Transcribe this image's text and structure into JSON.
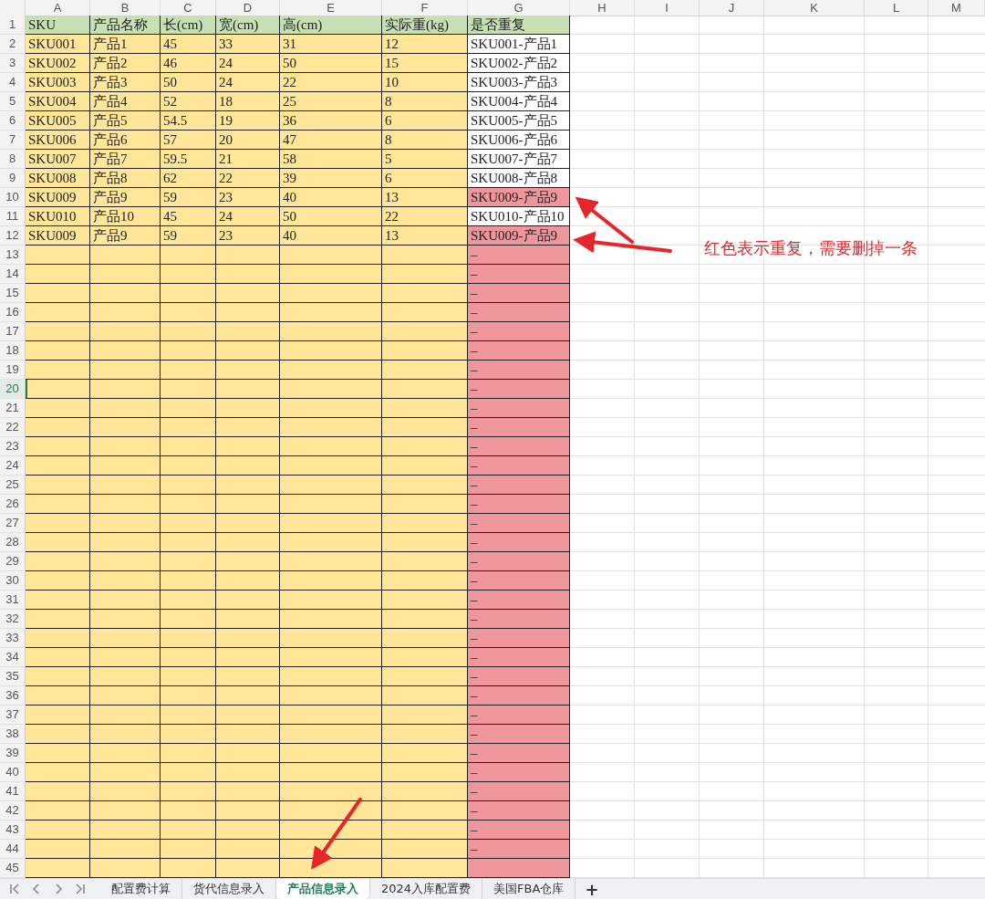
{
  "columns": [
    "A",
    "B",
    "C",
    "D",
    "E",
    "F",
    "G",
    "H",
    "I",
    "J",
    "K",
    "L",
    "M"
  ],
  "rows": [
    {
      "num": "1",
      "kind": "header",
      "selected": false,
      "cells": [
        "SKU",
        "产品名称",
        "长(cm)",
        "宽(cm)",
        "高(cm)",
        "实际重(kg)",
        "是否重复"
      ]
    },
    {
      "num": "2",
      "kind": "data",
      "selected": false,
      "duplicate": false,
      "cells": [
        "SKU001",
        "产品1",
        "45",
        "33",
        "31",
        "12",
        "SKU001-产品1"
      ]
    },
    {
      "num": "3",
      "kind": "data",
      "selected": false,
      "duplicate": false,
      "cells": [
        "SKU002",
        "产品2",
        "46",
        "24",
        "50",
        "15",
        "SKU002-产品2"
      ]
    },
    {
      "num": "4",
      "kind": "data",
      "selected": false,
      "duplicate": false,
      "cells": [
        "SKU003",
        "产品3",
        "50",
        "24",
        "22",
        "10",
        "SKU003-产品3"
      ]
    },
    {
      "num": "5",
      "kind": "data",
      "selected": false,
      "duplicate": false,
      "cells": [
        "SKU004",
        "产品4",
        "52",
        "18",
        "25",
        "8",
        "SKU004-产品4"
      ]
    },
    {
      "num": "6",
      "kind": "data",
      "selected": false,
      "duplicate": false,
      "cells": [
        "SKU005",
        "产品5",
        "54.5",
        "19",
        "36",
        "6",
        "SKU005-产品5"
      ]
    },
    {
      "num": "7",
      "kind": "data",
      "selected": false,
      "duplicate": false,
      "cells": [
        "SKU006",
        "产品6",
        "57",
        "20",
        "47",
        "8",
        "SKU006-产品6"
      ]
    },
    {
      "num": "8",
      "kind": "data",
      "selected": false,
      "duplicate": false,
      "cells": [
        "SKU007",
        "产品7",
        "59.5",
        "21",
        "58",
        "5",
        "SKU007-产品7"
      ]
    },
    {
      "num": "9",
      "kind": "data",
      "selected": false,
      "duplicate": false,
      "cells": [
        "SKU008",
        "产品8",
        "62",
        "22",
        "39",
        "6",
        "SKU008-产品8"
      ]
    },
    {
      "num": "10",
      "kind": "data",
      "selected": false,
      "duplicate": true,
      "cells": [
        "SKU009",
        "产品9",
        "59",
        "23",
        "40",
        "13",
        "SKU009-产品9"
      ]
    },
    {
      "num": "11",
      "kind": "data",
      "selected": false,
      "duplicate": false,
      "cells": [
        "SKU010",
        "产品10",
        "45",
        "24",
        "50",
        "22",
        "SKU010-产品10"
      ]
    },
    {
      "num": "12",
      "kind": "data",
      "selected": false,
      "duplicate": true,
      "cells": [
        "SKU009",
        "产品9",
        "59",
        "23",
        "40",
        "13",
        "SKU009-产品9"
      ]
    },
    {
      "num": "13",
      "kind": "blank",
      "selected": false,
      "duplicate": true,
      "check": "–"
    },
    {
      "num": "14",
      "kind": "blank",
      "selected": false,
      "duplicate": true,
      "check": "–"
    },
    {
      "num": "15",
      "kind": "blank",
      "selected": false,
      "duplicate": true,
      "check": "–"
    },
    {
      "num": "16",
      "kind": "blank",
      "selected": false,
      "duplicate": true,
      "check": "–"
    },
    {
      "num": "17",
      "kind": "blank",
      "selected": false,
      "duplicate": true,
      "check": "–"
    },
    {
      "num": "18",
      "kind": "blank",
      "selected": false,
      "duplicate": true,
      "check": "–"
    },
    {
      "num": "19",
      "kind": "blank",
      "selected": false,
      "duplicate": true,
      "check": "–"
    },
    {
      "num": "20",
      "kind": "blank",
      "selected": true,
      "duplicate": true,
      "check": "–"
    },
    {
      "num": "21",
      "kind": "blank",
      "selected": false,
      "duplicate": true,
      "check": "–"
    },
    {
      "num": "22",
      "kind": "blank",
      "selected": false,
      "duplicate": true,
      "check": "–"
    },
    {
      "num": "23",
      "kind": "blank",
      "selected": false,
      "duplicate": true,
      "check": "–"
    },
    {
      "num": "24",
      "kind": "blank",
      "selected": false,
      "duplicate": true,
      "check": "–"
    },
    {
      "num": "25",
      "kind": "blank",
      "selected": false,
      "duplicate": true,
      "check": "–"
    },
    {
      "num": "26",
      "kind": "blank",
      "selected": false,
      "duplicate": true,
      "check": "–"
    },
    {
      "num": "27",
      "kind": "blank",
      "selected": false,
      "duplicate": true,
      "check": "–"
    },
    {
      "num": "28",
      "kind": "blank",
      "selected": false,
      "duplicate": true,
      "check": "–"
    },
    {
      "num": "29",
      "kind": "blank",
      "selected": false,
      "duplicate": true,
      "check": "–"
    },
    {
      "num": "30",
      "kind": "blank",
      "selected": false,
      "duplicate": true,
      "check": "–"
    },
    {
      "num": "31",
      "kind": "blank",
      "selected": false,
      "duplicate": true,
      "check": "–"
    },
    {
      "num": "32",
      "kind": "blank",
      "selected": false,
      "duplicate": true,
      "check": "–"
    },
    {
      "num": "33",
      "kind": "blank",
      "selected": false,
      "duplicate": true,
      "check": "–"
    },
    {
      "num": "34",
      "kind": "blank",
      "selected": false,
      "duplicate": true,
      "check": "–"
    },
    {
      "num": "35",
      "kind": "blank",
      "selected": false,
      "duplicate": true,
      "check": "–"
    },
    {
      "num": "36",
      "kind": "blank",
      "selected": false,
      "duplicate": true,
      "check": "–"
    },
    {
      "num": "37",
      "kind": "blank",
      "selected": false,
      "duplicate": true,
      "check": "–"
    },
    {
      "num": "38",
      "kind": "blank",
      "selected": false,
      "duplicate": true,
      "check": "–"
    },
    {
      "num": "39",
      "kind": "blank",
      "selected": false,
      "duplicate": true,
      "check": "–"
    },
    {
      "num": "40",
      "kind": "blank",
      "selected": false,
      "duplicate": true,
      "check": "–"
    },
    {
      "num": "41",
      "kind": "blank",
      "selected": false,
      "duplicate": true,
      "check": "–"
    },
    {
      "num": "42",
      "kind": "blank",
      "selected": false,
      "duplicate": true,
      "check": "–"
    },
    {
      "num": "43",
      "kind": "blank",
      "selected": false,
      "duplicate": true,
      "check": "–"
    },
    {
      "num": "44",
      "kind": "blank",
      "selected": false,
      "duplicate": true,
      "check": "–"
    },
    {
      "num": "45",
      "kind": "blank",
      "selected": false,
      "duplicate": true
    }
  ],
  "annotation": "红色表示重复，需要删掉一条",
  "sheet_tabs": [
    {
      "label": "配置费计算",
      "selected": false
    },
    {
      "label": "货代信息录入",
      "selected": false
    },
    {
      "label": "产品信息录入",
      "selected": true
    },
    {
      "label": "2024入库配置费",
      "selected": false
    },
    {
      "label": "美国FBA仓库",
      "selected": false
    }
  ],
  "add_sheet": "+"
}
